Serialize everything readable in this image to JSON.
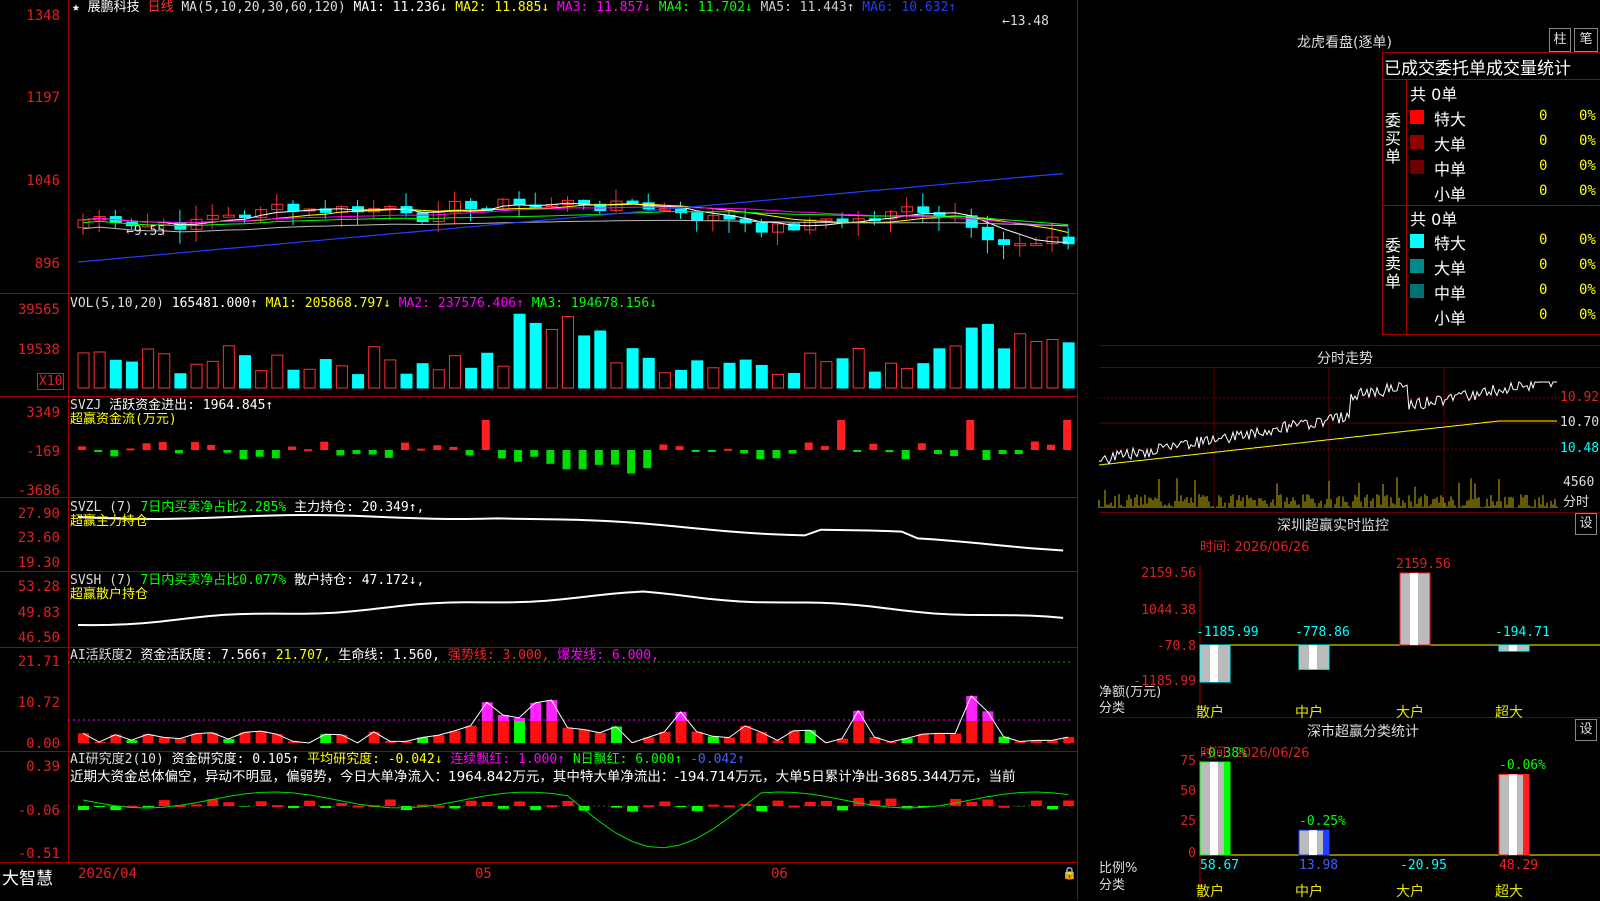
{
  "stock": {
    "star": "★",
    "name": "展鹏科技",
    "period": "日线"
  },
  "ma_header": {
    "label": "MA(5,10,20,30,60,120)",
    "ma1": "MA1: 11.236↓",
    "ma2": "MA2: 11.885↓",
    "ma3": "MA3: 11.857↓",
    "ma4": "MA4: 11.702↓",
    "ma5": "MA5: 11.443↑",
    "ma6": "MA6: 10.632↑"
  },
  "price_axis": [
    "1348",
    "1197",
    "1046",
    "896"
  ],
  "price_annotations": {
    "high": "13.48",
    "low": "9.55"
  },
  "vol_header": {
    "label": "VOL(5,10,20)",
    "value": "165481.000↑",
    "ma1": "MA1: 205868.797↓",
    "ma2": "MA2: 237576.406↑",
    "ma3": "MA3: 194678.156↓"
  },
  "vol_axis": [
    "39565",
    "19538"
  ],
  "vol_unit": "X10",
  "svzj_header": {
    "label": "SVZJ",
    "text": "活跃资金进出: 1964.845↑",
    "sub": "超赢资金流(万元)"
  },
  "svzj_axis": [
    "3349",
    "-169",
    "-3686"
  ],
  "svzl_header": {
    "label": "SVZL (7)",
    "net": "7日内买卖净占比2.285%",
    "hold": "主力持仓: 20.349↑,",
    "sub": "超赢主力持仓"
  },
  "svzl_axis": [
    "27.90",
    "23.60",
    "19.30"
  ],
  "svsh_header": {
    "label": "SVSH (7)",
    "net": "7日内买卖净占比0.077%",
    "hold": "散户持仓: 47.172↓,",
    "sub": "超赢散户持仓"
  },
  "svsh_axis": [
    "53.28",
    "49.83",
    "46.50"
  ],
  "ai2_header": {
    "label": "AI活跃度2",
    "a": "资金活跃度: 7.566↑",
    "b": "21.707,",
    "c": "生命线: 1.560,",
    "d": "强势线: 3.000,",
    "e": "爆发线: 6.000,"
  },
  "ai2_axis": [
    "21.71",
    "10.72",
    "0.00"
  ],
  "ai_research_header": {
    "label": "AI研究度2(10)",
    "a": "资金研究度: 0.105↑",
    "b": "平均研究度: -0.042↓",
    "c": "连续飘红: 1.000↑",
    "d": "N日飘红: 6.000↑",
    "e": "-0.042↑"
  },
  "ai_research_text": "近期大资金总体偏空，异动不明显，偏弱势，今日大单净流入：1964.842万元，其中特大单净流出：-194.714万元，大单5日累计净出-3685.344万元，当前",
  "ai_research_axis": [
    "0.39",
    "-0.06",
    "-0.51"
  ],
  "date_axis": {
    "d1": "2026/04",
    "d2": "05",
    "d3": "06"
  },
  "brand": "大智慧",
  "lhb": {
    "title": "龙虎看盘(逐单)",
    "btn1": "柱",
    "btn2": "笔",
    "subtitle": "已成交委托单成交量统计",
    "buy_label": "委买单",
    "sell_label": "委卖单",
    "buy_total": "共 0单",
    "sell_total": "共 0单",
    "buy_rows": [
      {
        "name": "特大",
        "val": "0",
        "pct": "0%",
        "color": "#ff0000"
      },
      {
        "name": "大单",
        "val": "0",
        "pct": "0%",
        "color": "#900000"
      },
      {
        "name": "中单",
        "val": "0",
        "pct": "0%",
        "color": "#700000"
      },
      {
        "name": "小单",
        "val": "0",
        "pct": "0%",
        "color": ""
      }
    ],
    "sell_rows": [
      {
        "name": "特大",
        "val": "0",
        "pct": "0%",
        "color": "#00ffff"
      },
      {
        "name": "大单",
        "val": "0",
        "pct": "0%",
        "color": "#008a8a"
      },
      {
        "name": "中单",
        "val": "0",
        "pct": "0%",
        "color": "#007070"
      },
      {
        "name": "小单",
        "val": "0",
        "pct": "0%",
        "color": ""
      }
    ]
  },
  "intraday": {
    "title": "分时走势",
    "axis": [
      "10.92",
      "10.70",
      "10.48"
    ],
    "vol_top": "4560",
    "vol_label": "分时"
  },
  "sz_monitor": {
    "title": "深圳超赢实时监控",
    "btn": "设",
    "time": "时间: 2026/06/26",
    "axis": [
      "2159.56",
      "1044.38",
      "-70.8",
      "-1185.99"
    ],
    "xlabel1": "净额(万元)",
    "xlabel2": "分类",
    "bars": [
      {
        "name": "散户",
        "value": -1185.99,
        "label": "-1185.99"
      },
      {
        "name": "中户",
        "value": -778.86,
        "label": "-778.86"
      },
      {
        "name": "大户",
        "value": 2159.56,
        "label": "2159.56"
      },
      {
        "name": "超大",
        "value": -194.71,
        "label": "-194.71"
      }
    ]
  },
  "sz_stats": {
    "title": "深市超赢分类统计",
    "btn": "设",
    "time": "时间: 2026/06/26",
    "axis": [
      "75",
      "50",
      "25",
      "0"
    ],
    "xlabel1": "比例%",
    "xlabel2": "分类",
    "bars": [
      {
        "name": "散户",
        "value": 75,
        "top": "-0.38%",
        "bottom": "58.67"
      },
      {
        "name": "中户",
        "value": 20,
        "top": "-0.25%",
        "bottom": "13.98"
      },
      {
        "name": "大户",
        "value": 0,
        "top": "",
        "bottom": "-20.95"
      },
      {
        "name": "超大",
        "value": 65,
        "top": "-0.06%",
        "bottom": "48.29"
      }
    ]
  },
  "chart_data": {
    "type": "bar",
    "title": "深圳超赢实时监控",
    "categories": [
      "散户",
      "中户",
      "大户",
      "超大"
    ],
    "series": [
      {
        "name": "净额(万元)",
        "values": [
          -1185.99,
          -778.86,
          2159.56,
          -194.71
        ]
      }
    ],
    "ylim": [
      -1185.99,
      2159.56
    ]
  }
}
